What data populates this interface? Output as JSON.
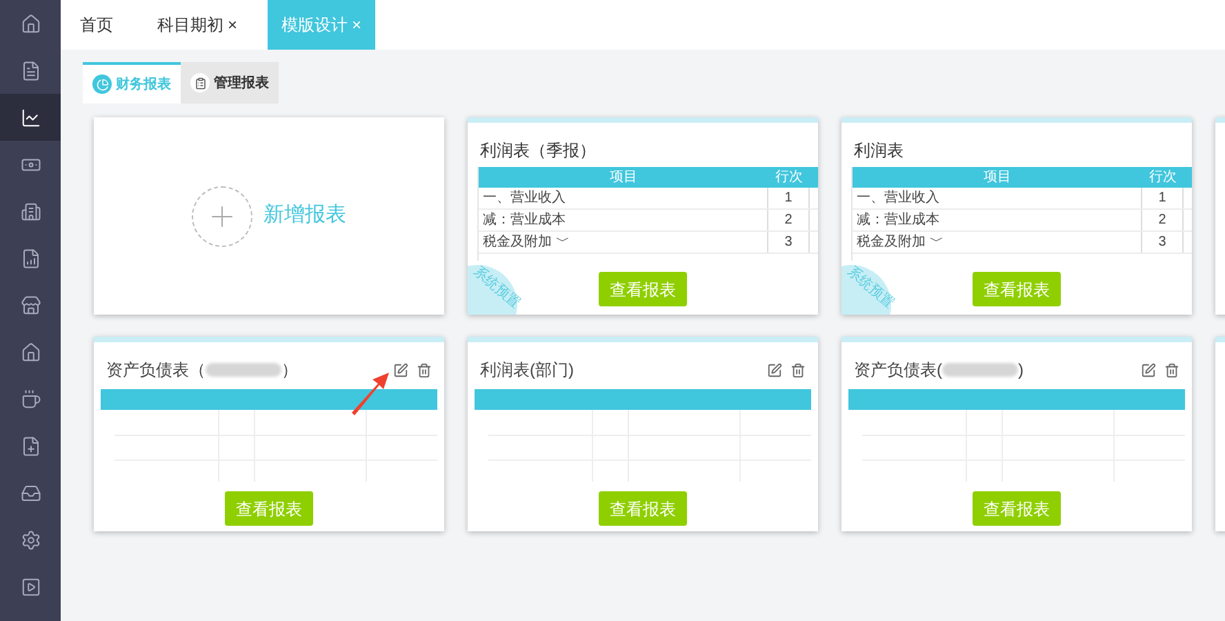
{
  "sidebar": {
    "items": [
      {
        "kind": "home",
        "selected": false
      },
      {
        "kind": "doc",
        "selected": false
      },
      {
        "kind": "chart",
        "selected": true
      },
      {
        "kind": "bag",
        "selected": false
      },
      {
        "kind": "building",
        "selected": false
      },
      {
        "kind": "report",
        "selected": false
      },
      {
        "kind": "store",
        "selected": false
      },
      {
        "kind": "house",
        "selected": false
      },
      {
        "kind": "cup",
        "selected": false
      },
      {
        "kind": "form",
        "selected": false
      },
      {
        "kind": "inbox",
        "selected": false
      },
      {
        "kind": "settings",
        "selected": false
      },
      {
        "kind": "video",
        "selected": false
      }
    ]
  },
  "tabs": [
    {
      "label": "首页",
      "selected": false,
      "closable": false
    },
    {
      "label": "科目期初",
      "selected": false,
      "closable": true,
      "close": "×"
    },
    {
      "label": "模版设计",
      "selected": true,
      "closable": true,
      "close": "×"
    }
  ],
  "subtabs": [
    {
      "label": "财务报表",
      "selected": true,
      "kind": "finance"
    },
    {
      "label": "管理报表",
      "selected": false,
      "kind": "manage"
    }
  ],
  "new_report": {
    "label": "新增报表"
  },
  "preset_cards": [
    {
      "title": "利润表（季报）",
      "columns": [
        "项目",
        "行次"
      ],
      "rows": [
        [
          "一、营业收入",
          "1"
        ],
        [
          "减：营业成本",
          "2"
        ],
        [
          "税金及附加 ﹀",
          "3"
        ]
      ],
      "badge": "系统预置",
      "button": "查看报表"
    },
    {
      "title": "利润表",
      "columns": [
        "项目",
        "行次"
      ],
      "rows": [
        [
          "一、营业收入",
          "1"
        ],
        [
          "减：营业成本",
          "2"
        ],
        [
          "税金及附加 ﹀",
          "3"
        ]
      ],
      "badge": "系统预置",
      "button": "查看报表"
    }
  ],
  "custom_cards": [
    {
      "title": "资产负债表（",
      "redacted": true,
      "title_end": "）",
      "button": "查看报表",
      "annotated": true
    },
    {
      "title": "利润表(部门)",
      "redacted": false,
      "button": "查看报表",
      "annotated": false
    },
    {
      "title": "资产负债表(",
      "redacted": true,
      "title_end": ")",
      "button": "查看报表",
      "annotated": false
    }
  ]
}
